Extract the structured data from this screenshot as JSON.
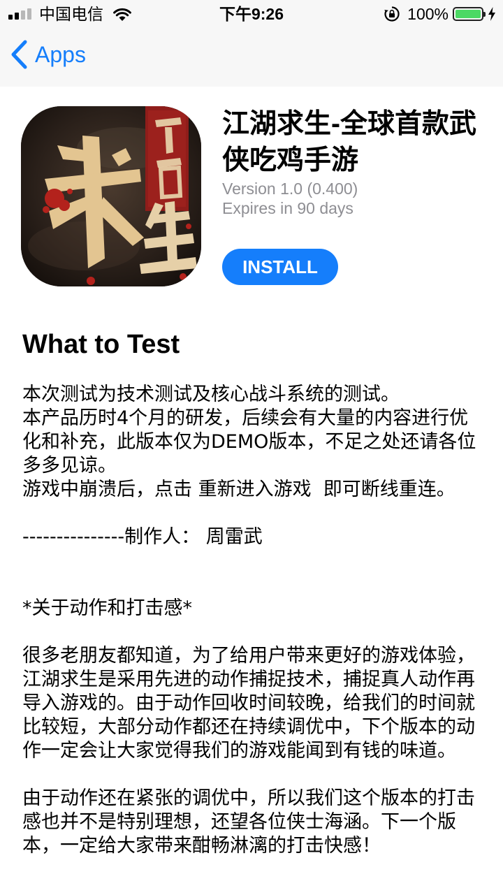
{
  "status_bar": {
    "carrier": "中国电信",
    "time": "下午9:26",
    "battery_percent": "100%",
    "signal_bars_filled": 2,
    "signal_bars_total": 4,
    "battery_level": 1.0,
    "battery_color": "#4cd964"
  },
  "nav": {
    "back_label": "Apps",
    "accent_color": "#157efb"
  },
  "app": {
    "name": "江湖求生-全球首款武侠吃鸡手游",
    "version": "Version 1.0 (0.400)",
    "expires": "Expires in 90 days",
    "install_label": "INSTALL",
    "icon_lettering": [
      "江",
      "湖",
      "求",
      "生"
    ]
  },
  "what_to_test": {
    "title": "What to Test",
    "body": "本次测试为技术测试及核心战斗系统的测试。\n本产品历时4个月的研发，后续会有大量的内容进行优化和补充，此版本仅为DEMO版本，不足之处还请各位多多见谅。\n游戏中崩溃后，点击 重新进入游戏  即可断线重连。\n\n---------------制作人： 周雷武\n\n\n*关于动作和打击感*\n\n很多老朋友都知道，为了给用户带来更好的游戏体验，江湖求生是采用先进的动作捕捉技术，捕捉真人动作再导入游戏的。由于动作回收时间较晚，给我们的时间就比较短，大部分动作都还在持续调优中，下个版本的动作一定会让大家觉得我们的游戏能闻到有钱的味道。\n\n由于动作还在紧张的调优中，所以我们这个版本的打击感也并不是特别理想，还望各位侠士海涵。下一个版本，一定给大家带来酣畅淋漓的打击快感！"
  }
}
